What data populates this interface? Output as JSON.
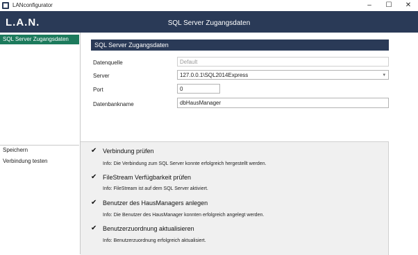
{
  "window": {
    "title": "LANconfigurator",
    "minimize": "–",
    "maximize": "☐",
    "close": "✕"
  },
  "header": {
    "logo": "L.A.N.",
    "title": "SQL Server Zugangsdaten"
  },
  "sidebar": {
    "active_item": "SQL Server Zugangsdaten",
    "actions": [
      "Speichern",
      "Verbindung testen"
    ]
  },
  "form": {
    "section_title": "SQL Server Zugangsdaten",
    "fields": [
      {
        "label": "Datenquelle",
        "value": "Default"
      },
      {
        "label": "Server",
        "value": "127.0.0.1\\SQL2014Express"
      },
      {
        "label": "Port",
        "value": "0"
      },
      {
        "label": "Datenbankname",
        "value": "dbHausManager"
      }
    ]
  },
  "steps": [
    {
      "title": "Verbindung prüfen",
      "info": "Info: Die Verbindung zum SQL Server konnte erfolgreich hergestellt werden."
    },
    {
      "title": "FileStream Verfügbarkeit prüfen",
      "info": "Info: FileStream ist auf dem SQL Server aktiviert."
    },
    {
      "title": "Benutzer des HausManagers anlegen",
      "info": "Info: Die Benutzer des HausManager konnten erfolgreich angelegt werden."
    },
    {
      "title": "Benutzerzuordnung aktualisieren",
      "info": "Info: Benutzerzuordnung erfolgreich aktualisiert."
    }
  ],
  "icons": {
    "check": "✔",
    "dropdown": "▾"
  },
  "colors": {
    "header": "#2a3a57",
    "active": "#1c7a5c",
    "panel": "#f0f0f0"
  }
}
